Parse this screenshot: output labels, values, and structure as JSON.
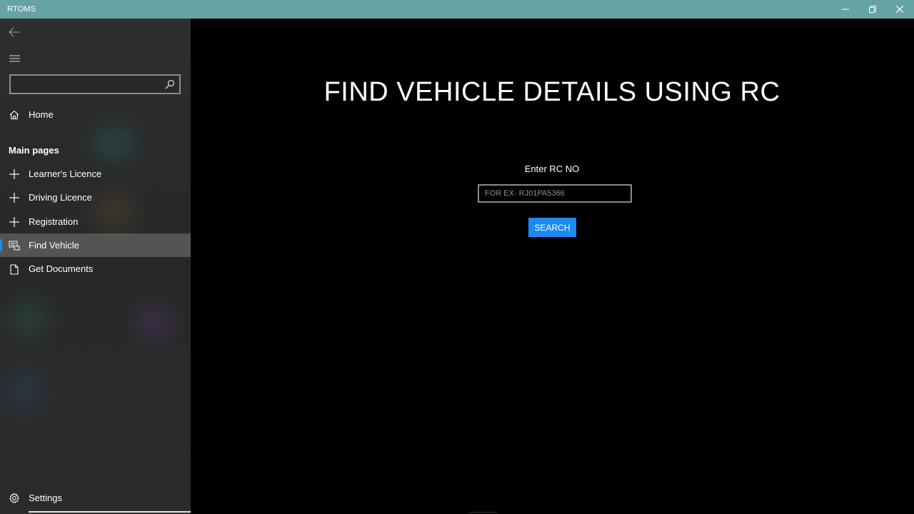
{
  "window": {
    "title": "RTOMS",
    "titlebar_color": "#66a3a4",
    "controls": [
      "minimize",
      "restore",
      "close"
    ]
  },
  "sidebar": {
    "search": {
      "value": "",
      "placeholder": ""
    },
    "home_label": "Home",
    "section_header": "Main pages",
    "items": [
      {
        "label": "Learner's Licence",
        "icon": "plus-icon",
        "selected": false
      },
      {
        "label": "Driving Licence",
        "icon": "plus-icon",
        "selected": false
      },
      {
        "label": "Registration",
        "icon": "plus-icon",
        "selected": false
      },
      {
        "label": "Find Vehicle",
        "icon": "vehicle-icon",
        "selected": true
      },
      {
        "label": "Get Documents",
        "icon": "document-icon",
        "selected": false
      }
    ],
    "settings_label": "Settings",
    "accent_color": "#1b8bf0"
  },
  "main": {
    "title": "FIND VEHICLE DETAILS USING RC",
    "rc_label": "Enter RC NO",
    "rc_input": {
      "value": "",
      "placeholder": "FOR EX- RJ01PA5366"
    },
    "search_button_label": "SEARCH",
    "button_color": "#1b8bf0"
  }
}
